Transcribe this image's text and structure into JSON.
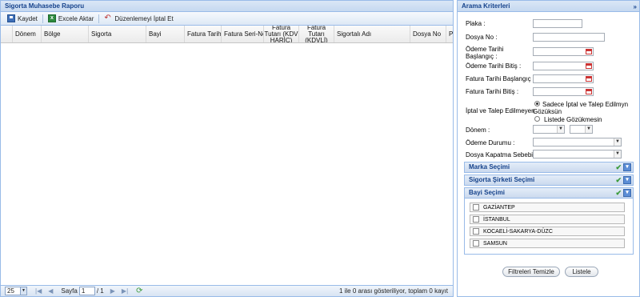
{
  "report": {
    "title": "Sigorta Muhasebe Raporu",
    "toolbar": {
      "save_label": "Kaydet",
      "excel_label": "Excele Aktar",
      "cancel_edit_label": "Düzenlemeyi İptal Et"
    },
    "columns": [
      "Dönem",
      "Bölge",
      "Sigorta",
      "Bayi",
      "Fatura Tarihi",
      "Fatura Seri-No",
      "Fatura Tutarı (KDV HARİÇ)",
      "Fatura Tutarı (KDVLİ)",
      "Sigortalı Adı",
      "Dosya No",
      "Pl"
    ],
    "pager": {
      "page_size": "25",
      "page_label": "Sayfa",
      "page_value": "1",
      "page_total": "/ 1",
      "info": "1 ile 0 arası gösteriliyor, toplam 0 kayıt"
    }
  },
  "criteria": {
    "title": "Arama Kriterleri",
    "collapse_icon": "»",
    "fields": {
      "plaka": "Plaka :",
      "dosya_no": "Dosya No :",
      "odeme_bas": "Ödeme Tarihi Başlangıç :",
      "odeme_bitis": "Ödeme Tarihi Bitiş :",
      "fatura_bas": "Fatura Tarihi Başlangıç :",
      "fatura_bitis": "Fatura Tarihi Bitiş :",
      "iptal_label": "İptal ve Talep Edilmeyen",
      "radio_sadece": "Sadece İptal ve Talep Edilmyn Gözüksün",
      "radio_listede": "Listede Gözükmesin",
      "donem": "Dönem :",
      "odeme_durumu": "Ödeme Durumu :",
      "dosya_kapatma": "Dosya Kapatma Sebebi :"
    },
    "sections": {
      "marka": "Marka Seçimi",
      "sigorta": "Sigorta Şirketi Seçimi",
      "bayi": "Bayi Seçimi"
    },
    "bayi_list": [
      "GAZİANTEP",
      "İSTANBUL",
      "KOCAELİ-SAKARYA-DÜZC",
      "SAMSUN"
    ],
    "buttons": {
      "clear": "Filtreleri Temizle",
      "list": "Listele"
    }
  },
  "colors": {
    "header_text": "#15428b",
    "border": "#99bbe8"
  }
}
